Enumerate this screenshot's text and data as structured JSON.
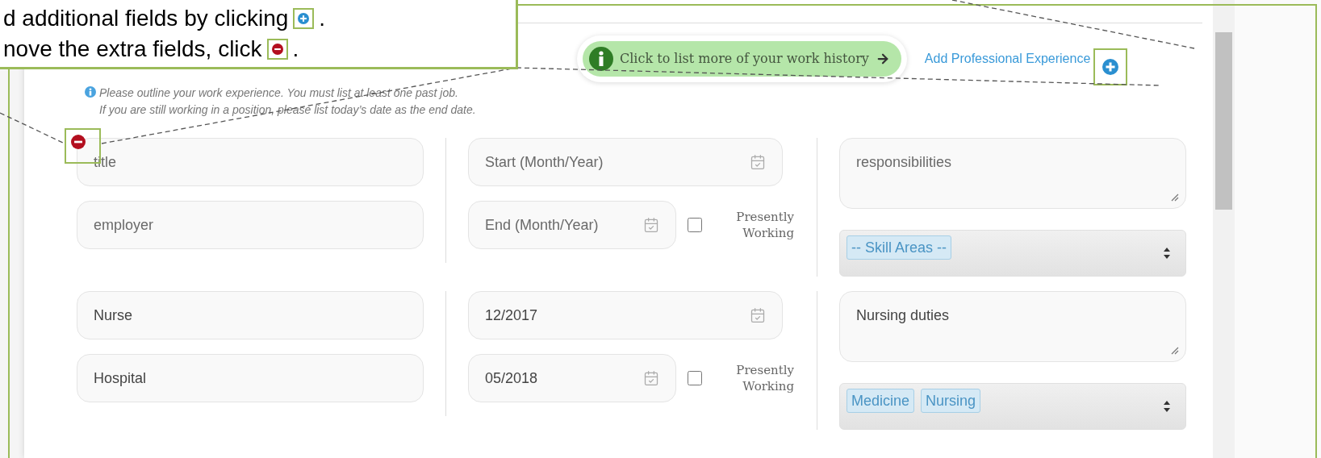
{
  "callout": {
    "lines": [
      {
        "text": "d additional fields by clicking",
        "kind": "add",
        "end": "."
      },
      {
        "text": "nove the extra fields, click",
        "kind": "remove",
        "end": "."
      }
    ]
  },
  "header": {
    "hint_pill": "Click to list more of your work history",
    "add_link": "Add Professional Experience"
  },
  "info": {
    "lines": [
      "Please outline your work experience. You must list at least one past job.",
      "If you are still working in a position, please list today’s date as the end date."
    ]
  },
  "entries": [
    {
      "remove_button": true,
      "title": {
        "placeholder": "title"
      },
      "employer": {
        "placeholder": "employer"
      },
      "start": {
        "placeholder": "Start (Month/Year)"
      },
      "end": {
        "placeholder": "End (Month/Year)"
      },
      "presently_working": {
        "label": "Presently Working",
        "checked": false
      },
      "responsibilities": {
        "placeholder": "responsibilities"
      },
      "skills": [
        "-- Skill Areas --"
      ]
    },
    {
      "remove_button": false,
      "title": {
        "value": "Nurse"
      },
      "employer": {
        "value": "Hospital"
      },
      "start": {
        "value": "12/2017"
      },
      "end": {
        "value": "05/2018"
      },
      "presently_working": {
        "label": "Presently Working",
        "checked": false
      },
      "responsibilities": {
        "value": "Nursing duties"
      },
      "skills": [
        "Medicine",
        "Nursing"
      ]
    }
  ]
}
